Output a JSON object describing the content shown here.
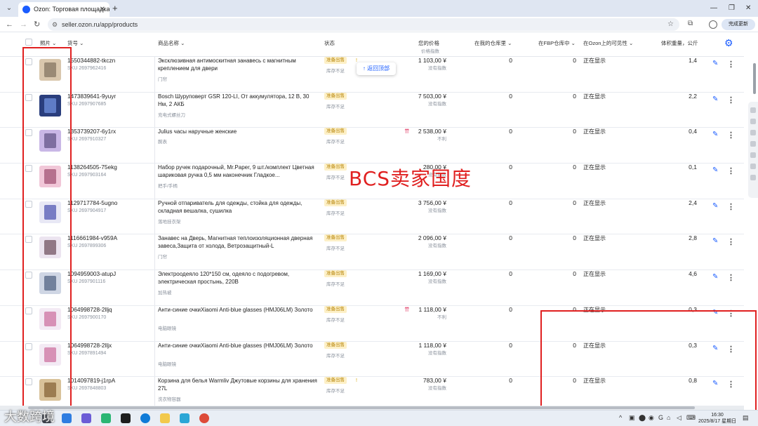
{
  "browser": {
    "tab_title": "Ozon: Торговая площадка",
    "url": "seller.ozon.ru/app/products",
    "update_label": "完成更新"
  },
  "table": {
    "headers": {
      "photo": "照片",
      "article": "货号",
      "product_name": "商品名称",
      "status": "状态",
      "your_price": "您的价格",
      "price_index": "价格指数",
      "in_my_warehouse": "在我的仓库里",
      "in_fbp_warehouse": "在FBP仓库中",
      "visibility": "在Ozon上的可见性",
      "volume_weight": "体积重量，公斤"
    },
    "rows": [
      {
        "article": "1550344882-tkczn",
        "sku": "SKU 2697962416",
        "name": "Эксклюзивная антимоскитная занавесь с магнитным креплением для двери",
        "category": "门帘",
        "status": "准备出售",
        "stock": "库存不足",
        "price": "1 103,00 ¥",
        "price_note": "没有指数",
        "my_wh": "0",
        "fbp_wh": "0",
        "visibility": "正在显示",
        "weight": "1,4",
        "dot": "!",
        "arrows": ""
      },
      {
        "article": "1473839641-9yuyr",
        "sku": "SKU 2697907685",
        "name": "Bosch Шуруповерт GSR 120-LI, От аккумулятора, 12 В, 30 Нм, 2 АКБ",
        "category": "充电式螺丝刀",
        "status": "准备出售",
        "stock": "库存不足",
        "price": "7 503,00 ¥",
        "price_note": "没有指数",
        "my_wh": "0",
        "fbp_wh": "0",
        "visibility": "正在显示",
        "weight": "2,2",
        "dot": "",
        "arrows": ""
      },
      {
        "article": "1353739207-6y1rx",
        "sku": "SKU 2697910327",
        "name": "Julius часы наручные женские",
        "category": "腕表",
        "status": "准备出售",
        "stock": "库存不足",
        "price": "2 538,00 ¥",
        "price_note": "不利",
        "my_wh": "0",
        "fbp_wh": "0",
        "visibility": "正在显示",
        "weight": "0,4",
        "dot": "",
        "arrows": "⇈"
      },
      {
        "article": "1138264505-75ekg",
        "sku": "SKU 2697903164",
        "name": "Набор ручек подарочный, Mr.Paper, 9 шт./комплект Цветная шариковая ручка 0,5 мм наконечник Гладкое...",
        "category": "把手/手柄",
        "status": "准备出售",
        "stock": "库存不足",
        "price": "280,00 ¥",
        "price_note": "没有指数",
        "my_wh": "0",
        "fbp_wh": "0",
        "visibility": "正在显示",
        "weight": "0,1",
        "dot": "",
        "arrows": ""
      },
      {
        "article": "1129717784-5ugno",
        "sku": "SKU 2697904917",
        "name": "Ручной отпариватель для одежды, стойка для одежды, складная вешалка, сушилка",
        "category": "落地挂衣架",
        "status": "准备出售",
        "stock": "库存不足",
        "price": "3 756,00 ¥",
        "price_note": "没有指数",
        "my_wh": "0",
        "fbp_wh": "0",
        "visibility": "正在显示",
        "weight": "2,4",
        "dot": "",
        "arrows": ""
      },
      {
        "article": "1116661984-v959A",
        "sku": "SKU 2697899306",
        "name": "Занавес на Дверь, Магнитная теплоизоляционная дверная завеса,Защита от холода, Ветрозащитный-L",
        "category": "门帘",
        "status": "准备出售",
        "stock": "库存不足",
        "price": "2 096,00 ¥",
        "price_note": "没有指数",
        "my_wh": "0",
        "fbp_wh": "0",
        "visibility": "正在显示",
        "weight": "2,8",
        "dot": "",
        "arrows": ""
      },
      {
        "article": "1094959003-atupJ",
        "sku": "SKU 2697901116",
        "name": "Электроодеяло 120*150 см, одеяло с подогревом, электрическая простынь, 220В",
        "category": "加热被",
        "status": "准备出售",
        "stock": "库存不足",
        "price": "1 169,00 ¥",
        "price_note": "没有指数",
        "my_wh": "0",
        "fbp_wh": "0",
        "visibility": "正在显示",
        "weight": "4,6",
        "dot": "",
        "arrows": ""
      },
      {
        "article": "1064998728-2lljq",
        "sku": "SKU 2697900170",
        "name": "Анти-синие очкиXiaomi Anti-blue glasses (HMJ06LM) Золото",
        "category": "电脑眼镜",
        "status": "准备出售",
        "stock": "库存不足",
        "price": "1 118,00 ¥",
        "price_note": "不利",
        "my_wh": "0",
        "fbp_wh": "0",
        "visibility": "正在显示",
        "weight": "0,3",
        "dot": "",
        "arrows": "⇈"
      },
      {
        "article": "1064998728-2lljx",
        "sku": "SKU 2697891494",
        "name": "Анти-синие очкиXiaomi Anti-blue glasses (HMJ06LM) Золото",
        "category": "电脑眼镜",
        "status": "准备出售",
        "stock": "库存不足",
        "price": "1 118,00 ¥",
        "price_note": "没有指数",
        "my_wh": "0",
        "fbp_wh": "0",
        "visibility": "正在显示",
        "weight": "0,3",
        "dot": "",
        "arrows": ""
      },
      {
        "article": "1014097819-j1rpA",
        "sku": "SKU 2697848803",
        "name": "Корзина для белья Warmliv Джутовые корзины для хранения 27L",
        "category": "洗衣物容器",
        "status": "准备出售",
        "stock": "库存不足",
        "price": "783,00 ¥",
        "price_note": "没有指数",
        "my_wh": "0",
        "fbp_wh": "0",
        "visibility": "正在显示",
        "weight": "0,8",
        "dot": "!",
        "arrows": ""
      }
    ]
  },
  "back_to_top": "↑ 返回顶部",
  "overlay_text": "BCS卖家国度",
  "corner_watermark": "大数跨境",
  "taskbar": {
    "time": "16:30",
    "date": "2025/8/17 星期日"
  },
  "colors": {
    "accent": "#1a5cff",
    "status_bg": "#fdf0c7",
    "status_text": "#b8860b",
    "annotation_red": "#e02020"
  }
}
